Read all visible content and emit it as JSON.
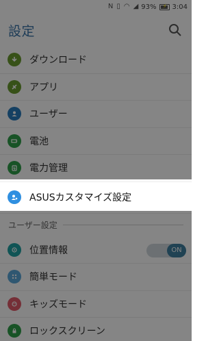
{
  "status_bar": {
    "left_icons": [
      "nfc-icon",
      "vibrate-icon",
      "wifi-icon",
      "signal-icon"
    ],
    "battery": "93%",
    "battery_level": 0.93,
    "time": "3:04"
  },
  "app_bar": {
    "title": "設定",
    "search_icon": "search-icon"
  },
  "items": [
    {
      "label": "ダウンロード",
      "icon": "download-icon",
      "color": "#6a9b2e"
    },
    {
      "label": "アプリ",
      "icon": "apps-icon",
      "color": "#6a9b2e"
    },
    {
      "label": "ユーザー",
      "icon": "user-icon",
      "color": "#2a7bbd"
    },
    {
      "label": "電池",
      "icon": "battery-icon",
      "color": "#2f9f4a"
    },
    {
      "label": "電力管理",
      "icon": "power-management-icon",
      "color": "#2f9f4a"
    },
    {
      "label": "ASUSカスタマイズ設定",
      "icon": "asus-customize-icon",
      "color": "#2f8fe0"
    }
  ],
  "section": {
    "title": "ユーザー設定"
  },
  "user_items": [
    {
      "label": "位置情報",
      "icon": "location-icon",
      "color": "#1fa2a3",
      "toggle": "ON"
    },
    {
      "label": "簡単モード",
      "icon": "easy-mode-icon",
      "color": "#5ba7d8"
    },
    {
      "label": "キッズモード",
      "icon": "kids-mode-icon",
      "color": "#e05a6a"
    },
    {
      "label": "ロックスクリーン",
      "icon": "lock-screen-icon",
      "color": "#2f9f4a"
    }
  ]
}
